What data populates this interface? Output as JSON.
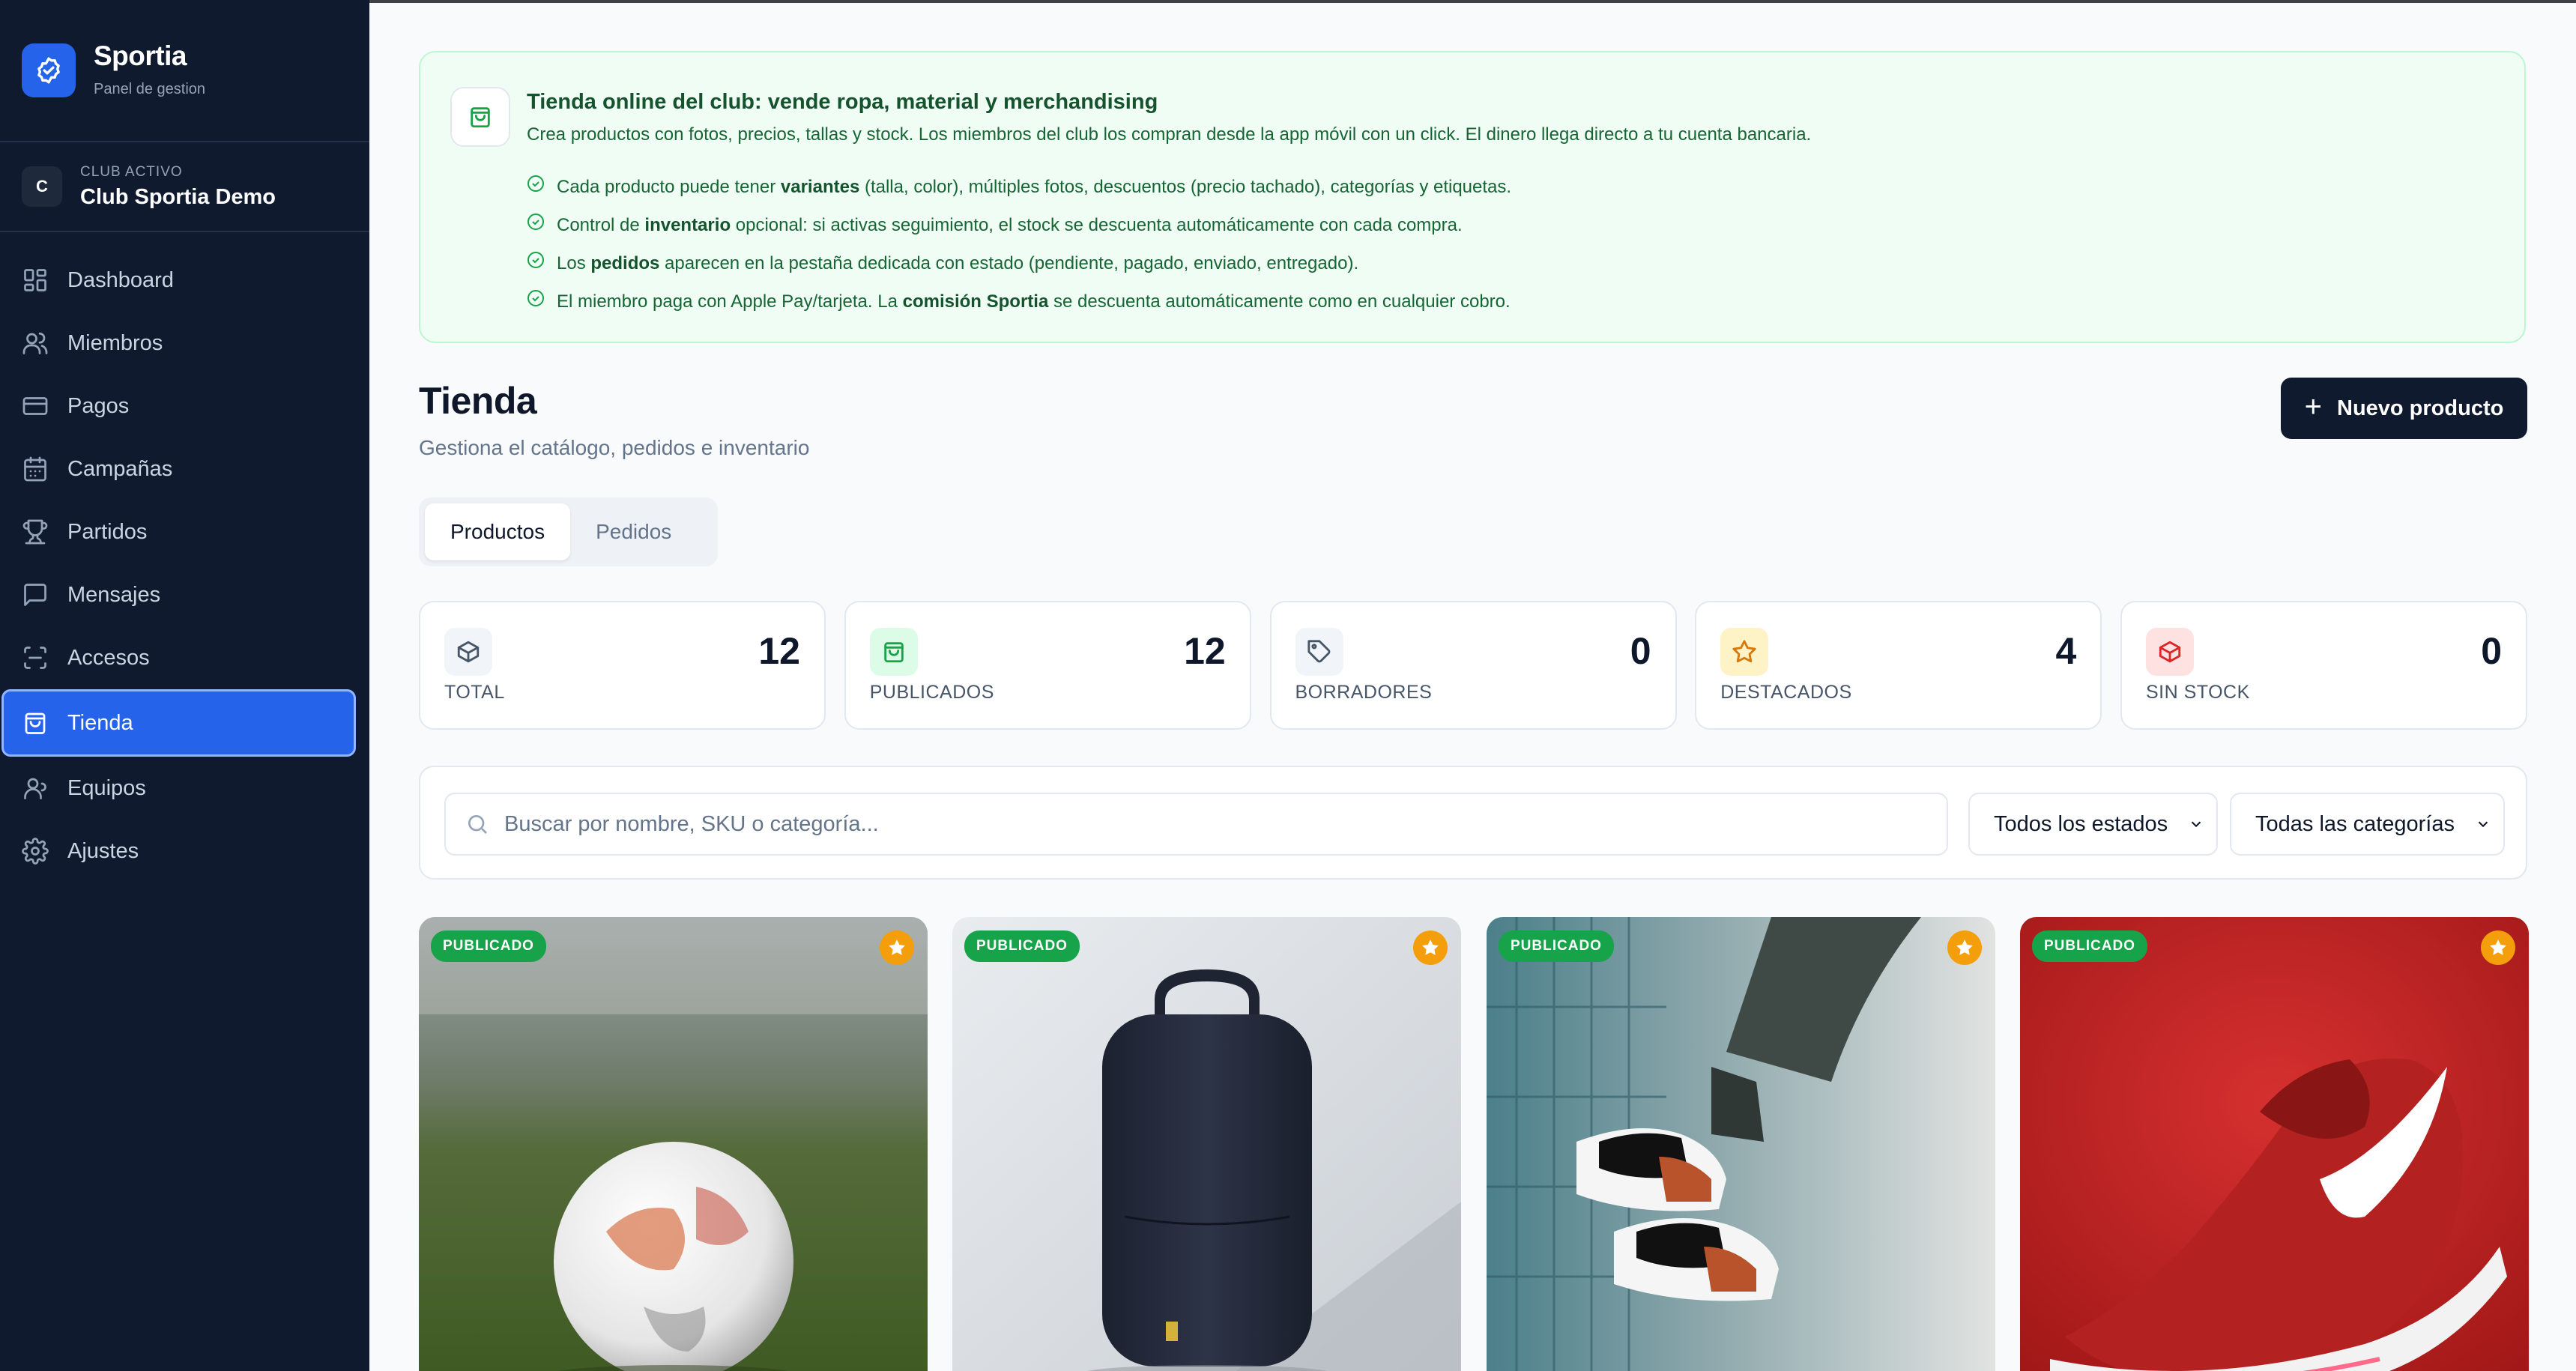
{
  "brand": {
    "name": "Sportia",
    "subtitle": "Panel de gestion"
  },
  "club": {
    "initial": "C",
    "label": "CLUB ACTIVO",
    "name": "Club Sportia Demo"
  },
  "nav": [
    {
      "label": "Dashboard",
      "icon": "dashboard-icon"
    },
    {
      "label": "Miembros",
      "icon": "users-icon"
    },
    {
      "label": "Pagos",
      "icon": "credit-card-icon"
    },
    {
      "label": "Campañas",
      "icon": "calendar-icon"
    },
    {
      "label": "Partidos",
      "icon": "trophy-icon"
    },
    {
      "label": "Mensajes",
      "icon": "message-icon"
    },
    {
      "label": "Accesos",
      "icon": "scan-icon"
    },
    {
      "label": "Tienda",
      "icon": "shopping-bag-icon",
      "active": true
    },
    {
      "label": "Equipos",
      "icon": "team-icon"
    },
    {
      "label": "Ajustes",
      "icon": "gear-icon"
    }
  ],
  "banner": {
    "title": "Tienda online del club: vende ropa, material y merchandising",
    "description": "Crea productos con fotos, precios, tallas y stock. Los miembros del club los compran desde la app móvil con un click. El dinero llega directo a tu cuenta bancaria.",
    "items": [
      {
        "pre": "Cada producto puede tener ",
        "bold": "variantes",
        "post": " (talla, color), múltiples fotos, descuentos (precio tachado), categorías y etiquetas."
      },
      {
        "pre": "Control de ",
        "bold": "inventario",
        "post": " opcional: si activas seguimiento, el stock se descuenta automáticamente con cada compra."
      },
      {
        "pre": "Los ",
        "bold": "pedidos",
        "post": " aparecen en la pestaña dedicada con estado (pendiente, pagado, enviado, entregado)."
      },
      {
        "pre": "El miembro paga con Apple Pay/tarjeta. La ",
        "bold": "comisión Sportia",
        "post": " se descuenta automáticamente como en cualquier cobro."
      }
    ]
  },
  "page": {
    "title": "Tienda",
    "subtitle": "Gestiona el catálogo, pedidos e inventario",
    "new_button": "Nuevo producto"
  },
  "tabs": [
    {
      "label": "Productos",
      "active": true
    },
    {
      "label": "Pedidos"
    }
  ],
  "stats": [
    {
      "label": "TOTAL",
      "value": "12",
      "icon": "box-icon",
      "color": "#475569",
      "bg": "#f1f5f9"
    },
    {
      "label": "PUBLICADOS",
      "value": "12",
      "icon": "shopping-bag-icon",
      "color": "#16a34a",
      "bg": "#dcfce7"
    },
    {
      "label": "BORRADORES",
      "value": "0",
      "icon": "tag-icon",
      "color": "#475569",
      "bg": "#f1f5f9"
    },
    {
      "label": "DESTACADOS",
      "value": "4",
      "icon": "star-icon",
      "color": "#d97706",
      "bg": "#fef3c7"
    },
    {
      "label": "SIN STOCK",
      "value": "0",
      "icon": "box-alert-icon",
      "color": "#dc2626",
      "bg": "#fee2e2"
    }
  ],
  "filters": {
    "search_placeholder": "Buscar por nombre, SKU o categoría...",
    "status_select": "Todos los estados",
    "category_select": "Todas las categorías"
  },
  "products": [
    {
      "badge": "PUBLICADO",
      "featured": true,
      "image": "soccer-ball"
    },
    {
      "badge": "PUBLICADO",
      "featured": true,
      "image": "backpack"
    },
    {
      "badge": "PUBLICADO",
      "featured": true,
      "image": "sneakers"
    },
    {
      "badge": "PUBLICADO",
      "featured": true,
      "image": "red-running-shoe"
    }
  ],
  "colors": {
    "sidebar": "#0f1a2e",
    "accent": "#2563eb",
    "success": "#16a34a",
    "featured": "#f59e0b"
  }
}
